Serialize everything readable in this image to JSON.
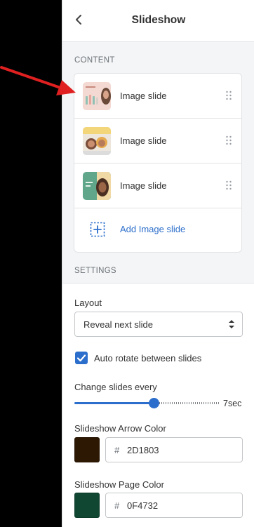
{
  "header": {
    "title": "Slideshow",
    "back_icon": "chevron-left-icon"
  },
  "content": {
    "section_label": "CONTENT",
    "slides": [
      {
        "label": "Image slide"
      },
      {
        "label": "Image slide"
      },
      {
        "label": "Image slide"
      }
    ],
    "add_label": "Add Image slide"
  },
  "settings": {
    "section_label": "SETTINGS",
    "layout": {
      "label": "Layout",
      "value": "Reveal next slide"
    },
    "auto_rotate": {
      "label": "Auto rotate between slides",
      "checked": true
    },
    "change_slides": {
      "label": "Change slides every",
      "value_text": "7sec",
      "fraction": 0.55
    },
    "arrow_color": {
      "label": "Slideshow Arrow Color",
      "prefix": "#",
      "hex": "2D1803",
      "color": "#2D1803"
    },
    "page_color": {
      "label": "Slideshow Page Color",
      "prefix": "#",
      "hex": "0F4732",
      "color": "#0F4732"
    }
  },
  "colors": {
    "accent": "#2c6ecb",
    "annotation_arrow": "#e02020"
  }
}
